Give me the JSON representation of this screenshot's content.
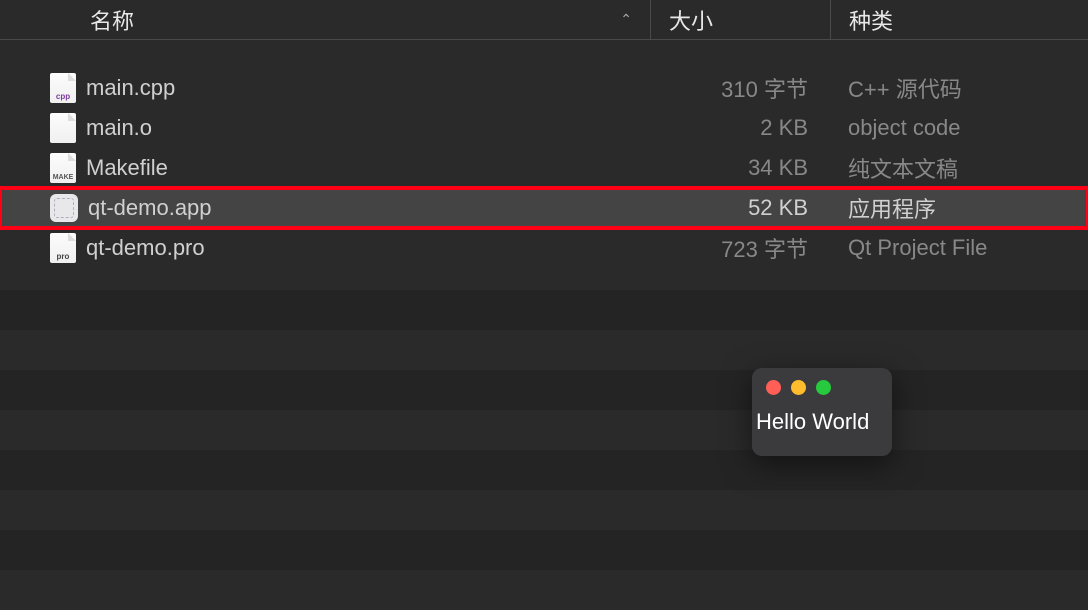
{
  "columns": {
    "name": "名称",
    "size": "大小",
    "kind": "种类"
  },
  "files": [
    {
      "name": "main.cpp",
      "size": "310 字节",
      "kind": "C++ 源代码",
      "icon": "cpp",
      "selected": false,
      "highlighted": false
    },
    {
      "name": "main.o",
      "size": "2 KB",
      "kind": "object code",
      "icon": "blank",
      "selected": false,
      "highlighted": false
    },
    {
      "name": "Makefile",
      "size": "34 KB",
      "kind": "纯文本文稿",
      "icon": "make",
      "selected": false,
      "highlighted": false
    },
    {
      "name": "qt-demo.app",
      "size": "52 KB",
      "kind": "应用程序",
      "icon": "app",
      "selected": true,
      "highlighted": true
    },
    {
      "name": "qt-demo.pro",
      "size": "723 字节",
      "kind": "Qt Project File",
      "icon": "pro",
      "selected": false,
      "highlighted": false
    }
  ],
  "hello_window": {
    "text": "Hello World"
  },
  "icon_labels": {
    "cpp": "cpp",
    "make": "MAKE",
    "pro": "pro"
  }
}
